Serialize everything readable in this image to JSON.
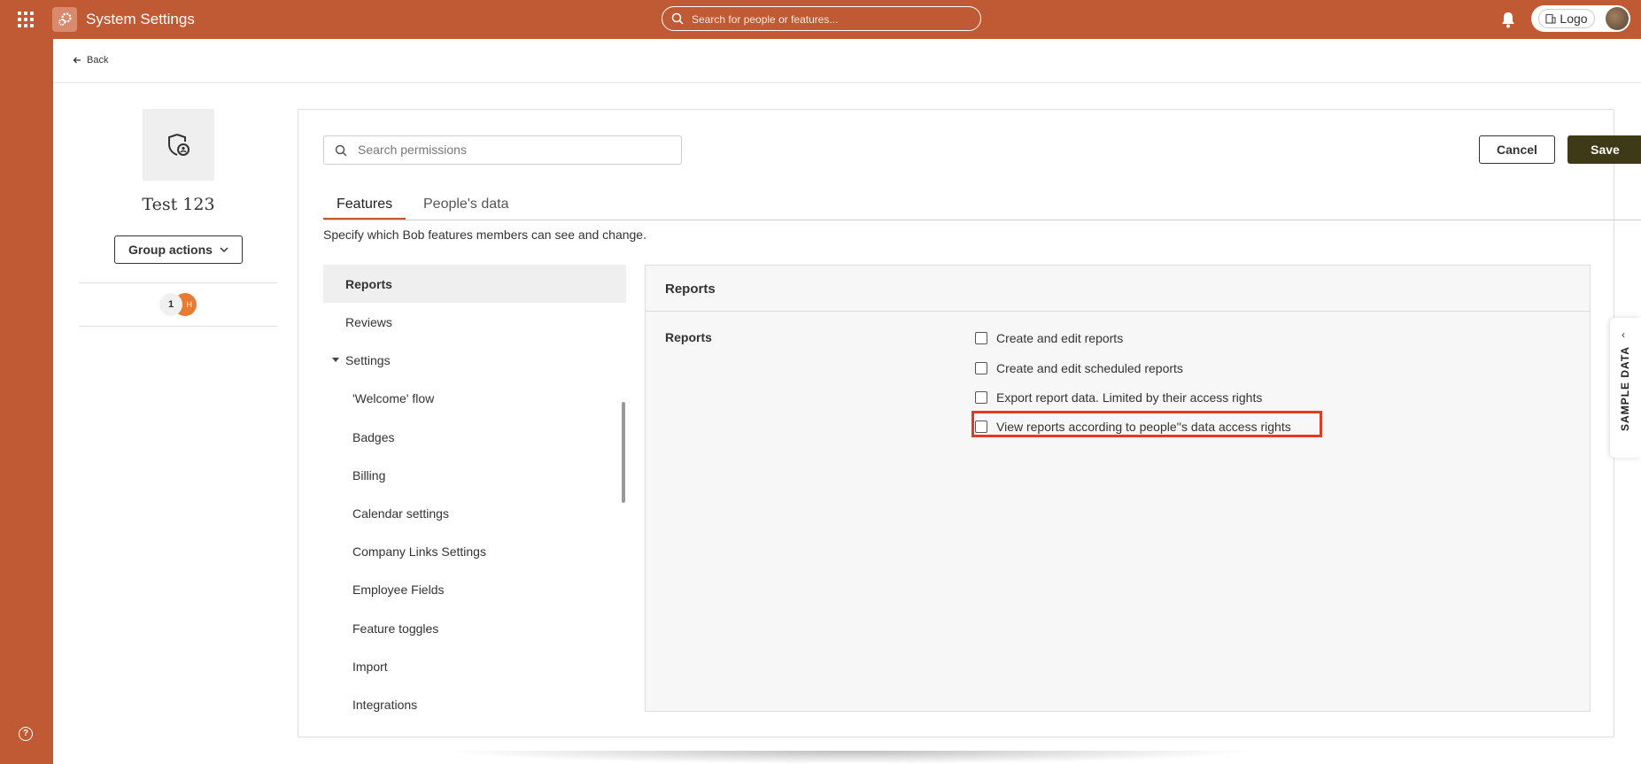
{
  "topbar": {
    "title": "System Settings",
    "search_placeholder": "Search for people or features...",
    "logo_label": "Logo"
  },
  "back": {
    "label": "Back"
  },
  "group": {
    "name": "Test 123",
    "actions_label": "Group actions",
    "member_count": "1",
    "member_initial": "H"
  },
  "toolbar": {
    "search_placeholder": "Search permissions",
    "cancel_label": "Cancel",
    "save_label": "Save"
  },
  "tabs": [
    {
      "label": "Features",
      "active": true
    },
    {
      "label": "People's data",
      "active": false
    }
  ],
  "description": "Specify which Bob features members can see and change.",
  "nav": {
    "items": [
      {
        "label": "Reports",
        "selected": true
      },
      {
        "label": "Reviews"
      },
      {
        "label": "Settings",
        "expanded": true
      },
      {
        "label": "'Welcome' flow"
      },
      {
        "label": "Badges"
      },
      {
        "label": "Billing"
      },
      {
        "label": "Calendar settings"
      },
      {
        "label": "Company Links Settings"
      },
      {
        "label": "Employee Fields"
      },
      {
        "label": "Feature toggles"
      },
      {
        "label": "Import"
      },
      {
        "label": "Integrations"
      }
    ]
  },
  "panel": {
    "title": "Reports",
    "section_label": "Reports",
    "permissions": [
      {
        "label": "Create and edit reports",
        "checked": false
      },
      {
        "label": "Create and edit scheduled reports",
        "checked": false
      },
      {
        "label": "Export report data. Limited by their access rights",
        "checked": false
      },
      {
        "label": "View reports according to people''s data access rights",
        "checked": false
      }
    ]
  },
  "sample_data": {
    "label": "SAMPLE DATA"
  },
  "colors": {
    "brand": "#c05a35",
    "save_button": "#3e3a17",
    "highlight": "#e53921"
  }
}
